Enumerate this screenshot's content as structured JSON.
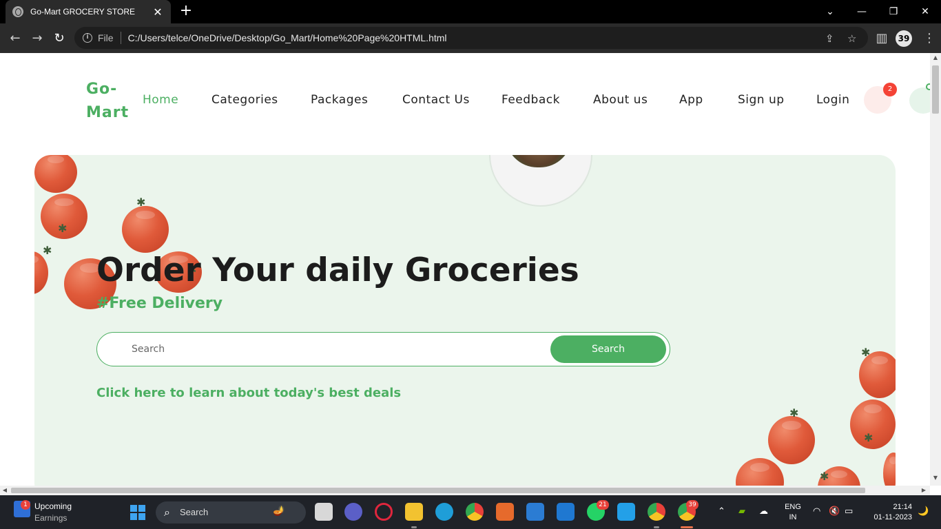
{
  "browser": {
    "tab_title": "Go-Mart GROCERY STORE",
    "new_tab_symbol": "+",
    "file_label": "File",
    "url": "C:/Users/telce/OneDrive/Desktop/Go_Mart/Home%20Page%20HTML.html",
    "profile_badge": "39"
  },
  "site": {
    "logo_line1": "Go-",
    "logo_line2": "Mart",
    "nav": [
      {
        "label": "Home",
        "active": true
      },
      {
        "label": "Categories",
        "active": false
      },
      {
        "label": "Packages",
        "active": false
      },
      {
        "label": "Contact Us",
        "active": false
      },
      {
        "label": "Feedback",
        "active": false
      },
      {
        "label": "About us",
        "active": false
      },
      {
        "label": "App",
        "active": false
      },
      {
        "label": "Sign up",
        "active": false
      },
      {
        "label": "Login",
        "active": false
      }
    ],
    "cart_count": "2",
    "accent_color": "#4caf62"
  },
  "hero": {
    "title": "Order Your daily Groceries",
    "subtitle": "#Free Delivery",
    "search_placeholder": "Search",
    "search_button": "Search",
    "deals_link": "Click here to learn about today's best deals"
  },
  "taskbar": {
    "widget_badge": "1",
    "widget_line1": "Upcoming",
    "widget_line2": "Earnings",
    "search_label": "Search",
    "whatsapp_badge": "21",
    "chrome_badge": "39",
    "lang_line1": "ENG",
    "lang_line2": "IN",
    "time": "21:14",
    "date": "01-11-2023"
  }
}
